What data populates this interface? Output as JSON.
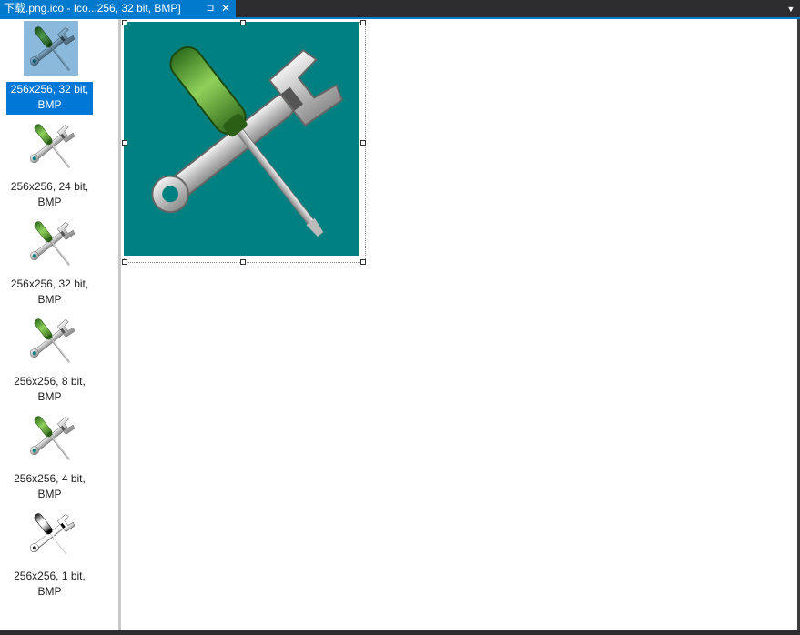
{
  "tab": {
    "title": "下载.png.ico - Ico...256, 32 bit, BMP]",
    "pin_glyph": "⊐",
    "close_glyph": "✕"
  },
  "overflow_glyph": "▼",
  "entries": [
    {
      "size": "256x256, 32 bit,",
      "format": "BMP",
      "icon": "wrench-screwdriver-blue-icon"
    },
    {
      "size": "256x256, 24 bit,",
      "format": "BMP",
      "icon": "wrench-screwdriver-green-icon"
    },
    {
      "size": "256x256, 32 bit,",
      "format": "BMP",
      "icon": "wrench-screwdriver-green-icon"
    },
    {
      "size": "256x256, 8 bit,",
      "format": "BMP",
      "icon": "wrench-screwdriver-green-icon"
    },
    {
      "size": "256x256, 4 bit,",
      "format": "BMP",
      "icon": "wrench-screwdriver-green-icon"
    },
    {
      "size": "256x256, 1 bit,",
      "format": "BMP",
      "icon": "wrench-screwdriver-black-icon"
    }
  ],
  "selected_entry": 0,
  "colors": {
    "accent": "#007acc",
    "selection": "#0078d7",
    "image_background": "#008080",
    "chrome": "#2d2d30"
  },
  "canvas_icon": "wrench-screwdriver-green-icon"
}
